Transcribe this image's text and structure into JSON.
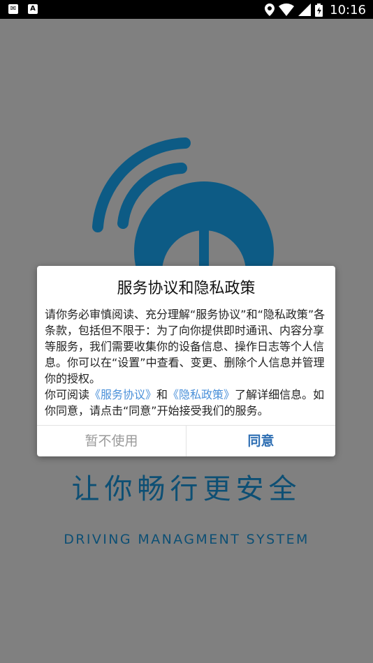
{
  "status_bar": {
    "time": "10:16",
    "left_icons": [
      "mail-notification-icon",
      "text-notification-icon"
    ],
    "right_icons": [
      "location-icon",
      "wifi-icon",
      "cell-signal-icon",
      "battery-icon"
    ]
  },
  "splash": {
    "logo": "wifi-speedometer-logo",
    "slogan": "让你畅行更安全",
    "subtitle": "DRIVING MANAGMENT SYSTEM",
    "brand_color": "#0d5b85"
  },
  "dialog": {
    "title": "服务协议和隐私政策",
    "body_part1": "请你务必审慎阅读、充分理解“服务协议”和“隐私政策”各条款，包括但不限于：为了向你提供即时通讯、内容分享等服务，我们需要收集你的设备信息、操作日志等个人信息。你可以在“设置”中查看、变更、删除个人信息并管理你的授权。",
    "body_part2_prefix": "你可阅读",
    "service_link": "《服务协议》",
    "body_and": "和",
    "privacy_link": "《隐私政策》",
    "body_part2_suffix": "了解详细信息。如你同意，请点击“同意”开始接受我们的服务。",
    "decline_label": "暂不使用",
    "agree_label": "同意",
    "link_color": "#4a90d9",
    "agree_color": "#2f6fb3"
  }
}
